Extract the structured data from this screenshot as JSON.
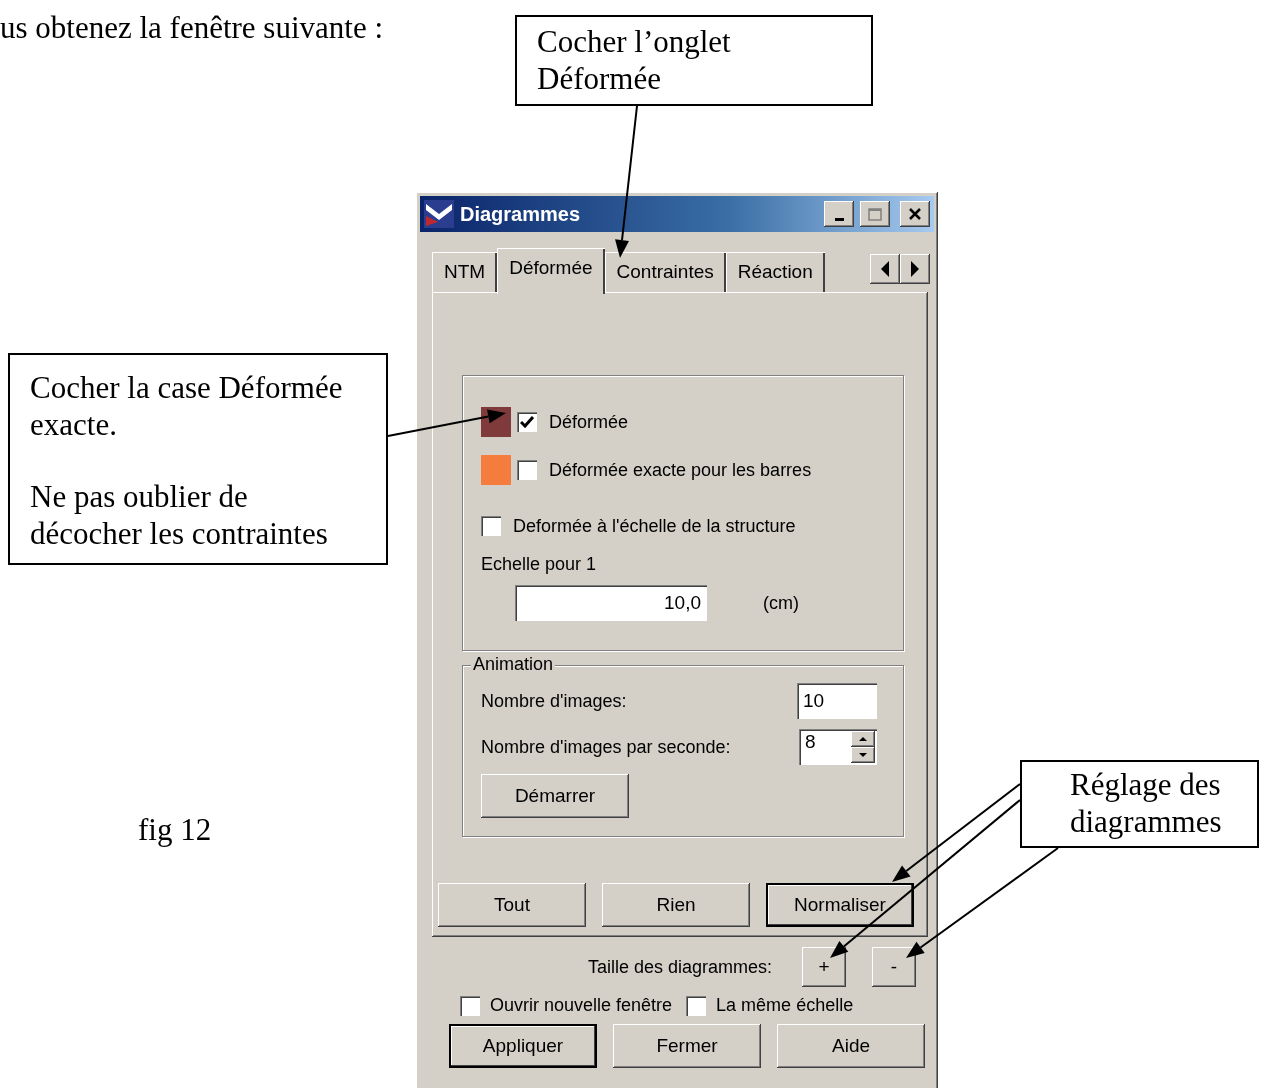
{
  "document": {
    "intro_text": "us obtenez la fenêtre suivante :",
    "figure_label": "fig 12"
  },
  "callouts": [
    {
      "kind": "top",
      "paragraphs": [
        "Cocher l’onglet Déformée"
      ]
    },
    {
      "kind": "left",
      "paragraphs": [
        "Cocher la case Déformée exacte.",
        "Ne pas oublier de décocher les contraintes"
      ]
    },
    {
      "kind": "right",
      "paragraphs": [
        "Réglage des diagrammes"
      ]
    }
  ],
  "window": {
    "title": "Diagrammes",
    "tabs": [
      {
        "label": "NTM",
        "selected": false
      },
      {
        "label": "Déformée",
        "selected": true
      },
      {
        "label": "Contraintes",
        "selected": false
      },
      {
        "label": "Réaction",
        "selected": false
      }
    ],
    "deformation_options": [
      {
        "label": "Déformée",
        "checked": true,
        "color": "#7f3b3b"
      },
      {
        "label": "Déformée exacte pour les barres",
        "checked": false,
        "color": "#f47c3c"
      },
      {
        "label": "Deformée à l'échelle de la structure",
        "checked": false
      }
    ],
    "scale": {
      "label": "Echelle pour 1",
      "value": "10,0",
      "unit": "(cm)"
    },
    "animation": {
      "title": "Animation",
      "frames_label": "Nombre d'images:",
      "frames_value": "10",
      "fps_label": "Nombre d'images par seconde:",
      "fps_value": "8",
      "start_button": "Démarrer"
    },
    "panel_buttons": [
      {
        "label": "Tout",
        "default": false
      },
      {
        "label": "Rien",
        "default": false
      },
      {
        "label": "Normaliser",
        "default": true
      }
    ],
    "size": {
      "label": "Taille des diagrammes:",
      "buttons": [
        "+",
        "-"
      ]
    },
    "footer_checkboxes": [
      {
        "label": "Ouvrir nouvelle fenêtre",
        "checked": false
      },
      {
        "label": "La même échelle",
        "checked": false
      }
    ],
    "footer_buttons": [
      {
        "label": "Appliquer",
        "default": true
      },
      {
        "label": "Fermer",
        "default": false
      },
      {
        "label": "Aide",
        "default": false
      }
    ]
  }
}
